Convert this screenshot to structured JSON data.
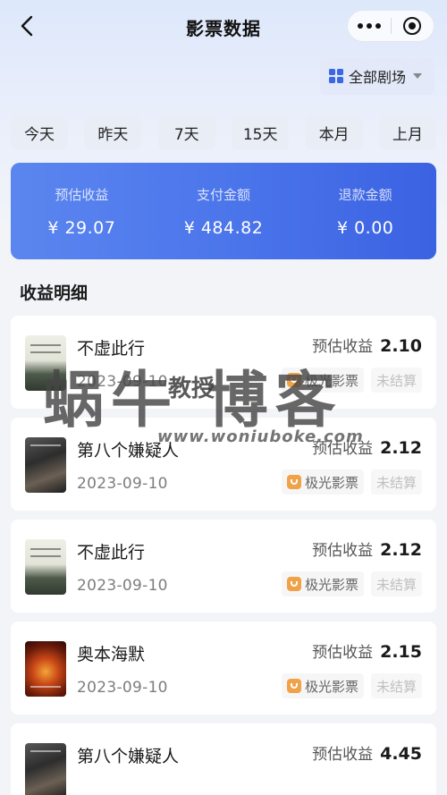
{
  "header": {
    "title": "影票数据",
    "back_icon": "chevron-left-icon",
    "more_icon": "more-dots-icon",
    "close_icon": "target-icon"
  },
  "venue_filter": {
    "label": "全部剧场",
    "icon": "grid-icon"
  },
  "period_tabs": [
    "今天",
    "昨天",
    "7天",
    "15天",
    "本月",
    "上月"
  ],
  "summary": {
    "accent": "#4a74ea",
    "stats": [
      {
        "label": "预估收益",
        "value": "¥ 29.07"
      },
      {
        "label": "支付金额",
        "value": "¥ 484.82"
      },
      {
        "label": "退款金额",
        "value": "¥ 0.00"
      }
    ]
  },
  "section_title": "收益明细",
  "records": [
    {
      "movie": "不虚此行",
      "date": "2023-09-10",
      "earn_label": "预估收益",
      "earn_value": "2.10",
      "platform": "极光影票",
      "status": "未结算"
    },
    {
      "movie": "第八个嫌疑人",
      "date": "2023-09-10",
      "earn_label": "预估收益",
      "earn_value": "2.12",
      "platform": "极光影票",
      "status": "未结算"
    },
    {
      "movie": "不虚此行",
      "date": "2023-09-10",
      "earn_label": "预估收益",
      "earn_value": "2.12",
      "platform": "极光影票",
      "status": "未结算"
    },
    {
      "movie": "奥本海默",
      "date": "2023-09-10",
      "earn_label": "预估收益",
      "earn_value": "2.15",
      "platform": "极光影票",
      "status": "未结算"
    },
    {
      "movie": "第八个嫌疑人",
      "date": "",
      "earn_label": "预估收益",
      "earn_value": "4.45",
      "platform": "",
      "status": ""
    }
  ],
  "watermark": {
    "main": "蜗牛 博客",
    "sub": "教授",
    "url": "www.woniuboke.com"
  }
}
